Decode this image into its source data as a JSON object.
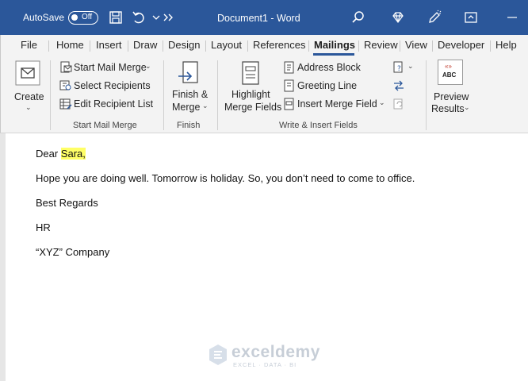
{
  "titlebar": {
    "autosave_label": "AutoSave",
    "autosave_state": "Off",
    "document_title": "Document1  -  Word"
  },
  "tabs": [
    {
      "label": "File"
    },
    {
      "label": "Home"
    },
    {
      "label": "Insert"
    },
    {
      "label": "Draw"
    },
    {
      "label": "Design"
    },
    {
      "label": "Layout"
    },
    {
      "label": "References"
    },
    {
      "label": "Mailings",
      "active": true
    },
    {
      "label": "Review"
    },
    {
      "label": "View"
    },
    {
      "label": "Developer"
    },
    {
      "label": "Help"
    }
  ],
  "ribbon": {
    "create": {
      "label": "Create"
    },
    "start_mail_merge": {
      "start": "Start Mail Merge",
      "select": "Select Recipients",
      "edit": "Edit Recipient List",
      "group_label": "Start Mail Merge"
    },
    "finish": {
      "label_line1": "Finish &",
      "label_line2": "Merge",
      "group_label": "Finish"
    },
    "write_insert": {
      "highlight_line1": "Highlight",
      "highlight_line2": "Merge Fields",
      "address_block": "Address Block",
      "greeting_line": "Greeting Line",
      "insert_merge_field": "Insert Merge Field",
      "group_label": "Write & Insert Fields"
    },
    "preview": {
      "icon_text": "ABC",
      "label_line1": "Preview",
      "label_line2": "Results"
    }
  },
  "document": {
    "greeting_prefix": "Dear ",
    "greeting_name": "Sara,",
    "body": "Hope you are doing well. Tomorrow is holiday. So, you don’t need to come to office.",
    "closing": "Best Regards",
    "sender": "HR",
    "company": "“XYZ” Company"
  },
  "watermark": {
    "brand": "exceldemy",
    "tagline": "EXCEL · DATA · BI"
  },
  "colors": {
    "titlebar": "#2b579a",
    "highlight": "#ffff66"
  }
}
